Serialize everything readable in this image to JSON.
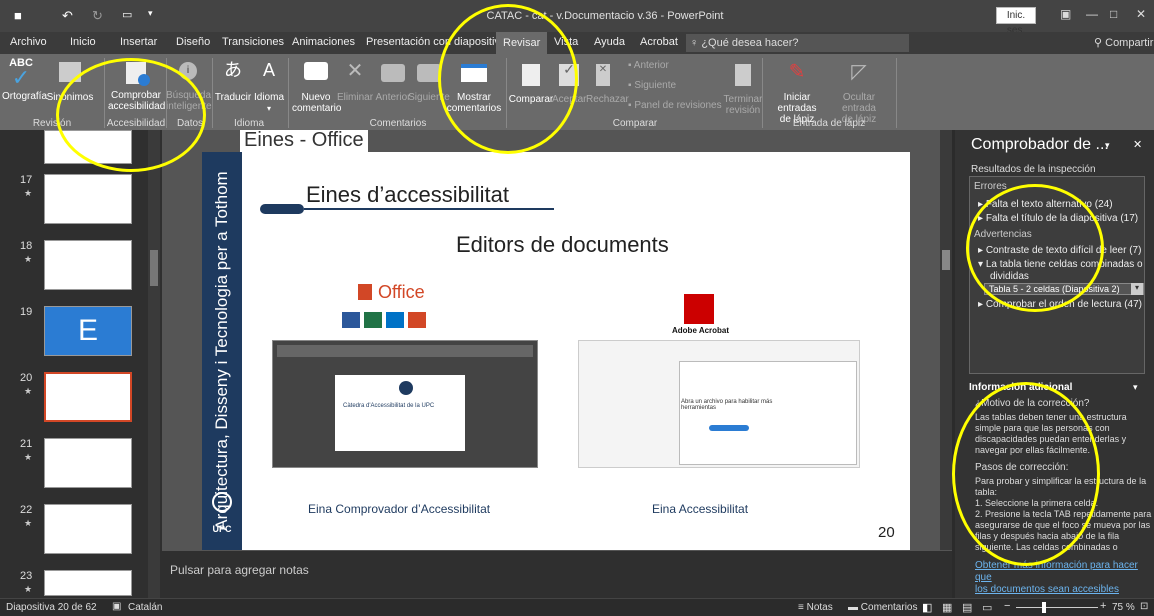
{
  "window": {
    "title": "CATAC - cat - v.Documentacio v.36 - PowerPoint",
    "signin": "Inic. ses.",
    "save_icon": "■",
    "undo_icon": "↶",
    "redo_icon": "↻",
    "more_icon": "▾",
    "ribbon_opts_icon": "▣",
    "minimize": "—",
    "maximize": "□",
    "close": "✕"
  },
  "tabs": [
    "Archivo",
    "Inicio",
    "Insertar",
    "Diseño",
    "Transiciones",
    "Animaciones",
    "Presentación con diapositivas",
    "Revisar",
    "Vista",
    "Ayuda",
    "Acrobat"
  ],
  "tellme": "¿Qué desea hacer?",
  "share": "Compartir",
  "ribbon": {
    "ortografia": "Ortografía",
    "sinonimos": "Sinónimos",
    "comprobar": [
      "Comprobar",
      "accesibilidad"
    ],
    "busqueda": [
      "Búsqueda",
      "inteligente"
    ],
    "traducir": "Traducir",
    "idioma": "Idioma",
    "nuevo": [
      "Nuevo",
      "comentario"
    ],
    "eliminar": "Eliminar",
    "anterior": "Anterior",
    "siguiente": "Siguiente",
    "mostrar": [
      "Mostrar",
      "comentarios"
    ],
    "comparar": "Comparar",
    "aceptar": "Aceptar",
    "rechazar": "Rechazar",
    "anterior2": "Anterior",
    "siguiente2": "Siguiente",
    "panel": "Panel de revisiones",
    "terminar": [
      "Terminar",
      "revisión"
    ],
    "iniciar": [
      "Iniciar entradas",
      "de lápiz"
    ],
    "ocultar": [
      "Ocultar entrada",
      "de lápiz"
    ],
    "groups": [
      "Revisión",
      "Accesibilidad",
      "Datos",
      "Idioma",
      "Comentarios",
      "Comparar",
      "Entrada de lápiz"
    ]
  },
  "slides": [
    {
      "num": "17",
      "star": "★"
    },
    {
      "num": "18",
      "star": "★"
    },
    {
      "num": "19",
      "star": ""
    },
    {
      "num": "20",
      "star": "★"
    },
    {
      "num": "21",
      "star": "★"
    },
    {
      "num": "22",
      "star": "★"
    },
    {
      "num": "23",
      "star": "★"
    }
  ],
  "slide": {
    "top_title": "Eines - Office",
    "vertical": "Arquitectura, Disseny i Tecnologia per a Tothom",
    "upc": "UPC",
    "heading": "Eines d’accessibilitat",
    "subheading": "Editors de documents",
    "office": "Office",
    "adobe": "Adobe Acrobat",
    "left_caption": "Eina Comprovador d’Accessibilitat",
    "right_caption": "Eina Accessibilitat",
    "number": "20",
    "acrobat_msg": "Abra un archivo para habilitar más herramientas",
    "upc_text": "Càtedra d'Accessibilitat de la UPC"
  },
  "notes": "Pulsar para agregar notas",
  "pane": {
    "title": "Comprobador de ...",
    "results": "Resultados de la inspección",
    "errors": "Errores",
    "err1": "Falta el texto alternativo (24)",
    "err2": "Falta el título de la diapositiva (17)",
    "warnings": "Advertencias",
    "warn1": "Contraste de texto difícil de leer (7)",
    "warn2a": "La tabla tiene celdas combinadas o",
    "warn2b": "divididas",
    "warn2sel": "Tabla 5 - 2 celdas (Diapositiva 2)",
    "warn3": "Comprobar el orden de lectura (47)",
    "info_title": "Información adicional",
    "why": "¿Motivo de la corrección?",
    "why_text": [
      "Las tablas deben tener una estructura",
      "simple para que las personas con",
      "discapacidades puedan entenderlas y",
      "navegar por ellas fácilmente."
    ],
    "steps": "Pasos de corrección:",
    "steps_text": [
      "Para probar y simplificar la estructura de la",
      "tabla:",
      "1. Seleccione la primera celda.",
      "2. Presione la tecla TAB repetidamente para",
      "asegurarse de que el foco se mueva por las",
      "filas y después hacia abajo de la fila",
      "siguiente. Las celdas combinadas o"
    ],
    "link": [
      "Obtener más información para hacer que",
      "los documentos sean accesibles"
    ]
  },
  "status": {
    "slide": "Diapositiva 20 de 62",
    "lang": "Catalán",
    "notes": "Notas",
    "comments": "Comentarios",
    "zoom": "75 %"
  },
  "colors": {
    "accent": "#d24726",
    "highlight": "#ffff00",
    "link": "#6cb4ee"
  }
}
